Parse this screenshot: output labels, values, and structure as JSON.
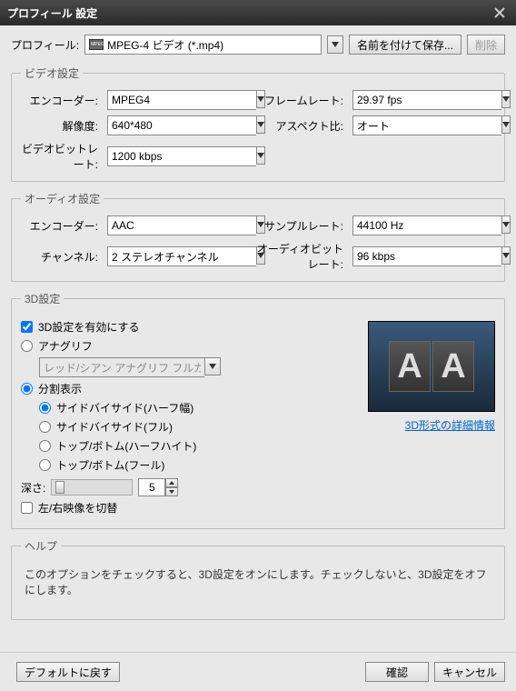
{
  "window_title": "プロフィール 設定",
  "profile": {
    "label": "プロフィール:",
    "selected": "MPEG-4 ビデオ (*.mp4)",
    "save_as": "名前を付けて保存...",
    "delete": "削除"
  },
  "video": {
    "legend": "ビデオ設定",
    "encoder_label": "エンコーダー:",
    "encoder_value": "MPEG4",
    "framerate_label": "フレームレート:",
    "framerate_value": "29.97 fps",
    "resolution_label": "解像度:",
    "resolution_value": "640*480",
    "aspect_label": "アスペクト比:",
    "aspect_value": "オート",
    "bitrate_label": "ビデオビットレート:",
    "bitrate_value": "1200 kbps"
  },
  "audio": {
    "legend": "オーディオ設定",
    "encoder_label": "エンコーダー:",
    "encoder_value": "AAC",
    "samplerate_label": "サンプルレート:",
    "samplerate_value": "44100 Hz",
    "channel_label": "チャンネル:",
    "channel_value": "2 ステレオチャンネル",
    "bitrate_label": "オーディオビットレート:",
    "bitrate_value": "96 kbps"
  },
  "three_d": {
    "legend": "3D設定",
    "enable": "3D設定を有効にする",
    "anaglyph": "アナグリフ",
    "anaglyph_mode": "レッド/シアン アナグリフ フルカラー",
    "split": "分割表示",
    "sbs_half": "サイドバイサイド(ハーフ幅)",
    "sbs_full": "サイドバイサイド(フル)",
    "tb_half": "トップ/ボトム(ハーフハイト)",
    "tb_full": "トップ/ボトム(フール)",
    "depth_label": "深さ:",
    "depth_value": "5",
    "swap": "左/右映像を切替",
    "link": "3D形式の詳細情報"
  },
  "help": {
    "legend": "ヘルプ",
    "text": "このオプションをチェックすると、3D設定をオンにします。チェックしないと、3D設定をオフにします。"
  },
  "footer": {
    "default": "デフォルトに戻す",
    "ok": "確認",
    "cancel": "キャンセル"
  }
}
